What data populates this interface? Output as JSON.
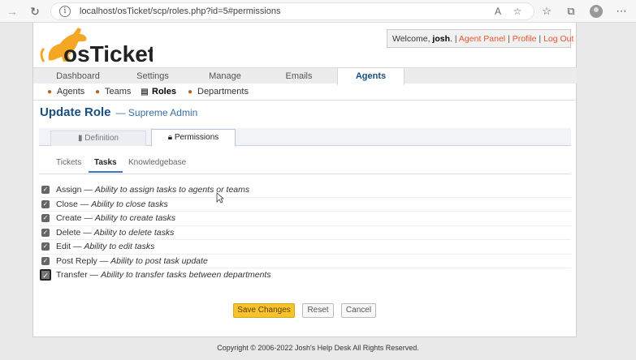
{
  "browser": {
    "url": "localhost/osTicket/scp/roles.php?id=5#permissions",
    "icons": [
      "back-icon",
      "refresh-icon",
      "info-icon",
      "read-aloud-icon",
      "favorite-add-icon",
      "favorites-icon",
      "collections-icon",
      "profile-icon",
      "more-icon"
    ]
  },
  "header": {
    "logo_text": "osTicket",
    "welcome_prefix": "Welcome, ",
    "username": "josh",
    "welcome_suffix": ". ",
    "links": [
      "Agent Panel",
      "Profile",
      "Log Out"
    ],
    "separator": "|"
  },
  "nav": {
    "tabs": [
      "Dashboard",
      "Settings",
      "Manage",
      "Emails",
      "Agents"
    ],
    "active": "Agents"
  },
  "subnav": {
    "items": [
      {
        "label": "Agents",
        "icon": "agent-icon"
      },
      {
        "label": "Teams",
        "icon": "teams-icon"
      },
      {
        "label": "Roles",
        "icon": "roles-icon"
      },
      {
        "label": "Departments",
        "icon": "departments-icon"
      }
    ],
    "active": "Roles"
  },
  "page": {
    "title": "Update Role",
    "subtitle": "— Supreme Admin"
  },
  "tabs": {
    "definition": "Definition",
    "permissions": "Permissions",
    "active": "Permissions"
  },
  "subtabs": {
    "items": [
      "Tickets",
      "Tasks",
      "Knowledgebase"
    ],
    "active": "Tasks"
  },
  "permissions": [
    {
      "name": "Assign",
      "desc": "Ability to assign tasks to agents or teams",
      "checked": true
    },
    {
      "name": "Close",
      "desc": "Ability to close tasks",
      "checked": true
    },
    {
      "name": "Create",
      "desc": "Ability to create tasks",
      "checked": true
    },
    {
      "name": "Delete",
      "desc": "Ability to delete tasks",
      "checked": true
    },
    {
      "name": "Edit",
      "desc": "Ability to edit tasks",
      "checked": true
    },
    {
      "name": "Post Reply",
      "desc": "Ability to post task update",
      "checked": true
    },
    {
      "name": "Transfer",
      "desc": "Ability to transfer tasks between departments",
      "checked": true
    }
  ],
  "perm_separator": " — ",
  "buttons": {
    "save": "Save Changes",
    "reset": "Reset",
    "cancel": "Cancel"
  },
  "footer": "Copyright © 2006-2022 Josh's Help Desk All Rights Reserved.",
  "colors": {
    "brand_orange": "#f5a623",
    "link": "#e8552d",
    "title_blue": "#184e81",
    "save_button": "#f5c32c"
  }
}
